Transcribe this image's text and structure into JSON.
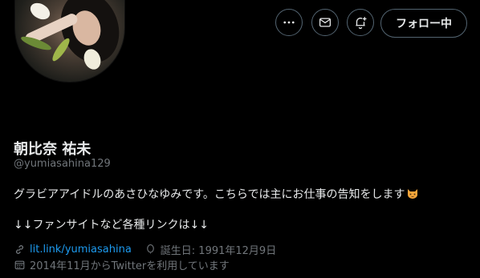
{
  "profile": {
    "display_name": "朝比奈 祐未",
    "handle": "@yumiasahina129",
    "bio_line1": "グラビアアイドルのあさひなゆみです。こちらでは主にお仕事の告知をします",
    "bio_line2": "↓↓ファンサイトなど各種リンクは↓↓",
    "link_text": "lit.link/yumiasahina",
    "birthday": "誕生日: 1991年12月9日",
    "joined": "2014年11月からTwitterを利用しています"
  },
  "actions": {
    "more_icon": "more-horizontal-icon",
    "message_icon": "envelope-icon",
    "notify_icon": "bell-plus-icon",
    "follow_label": "フォロー中"
  },
  "colors": {
    "background": "#000000",
    "text": "#e7e9ea",
    "secondary": "#71767b",
    "link": "#1d9bf0",
    "border": "#536471"
  }
}
